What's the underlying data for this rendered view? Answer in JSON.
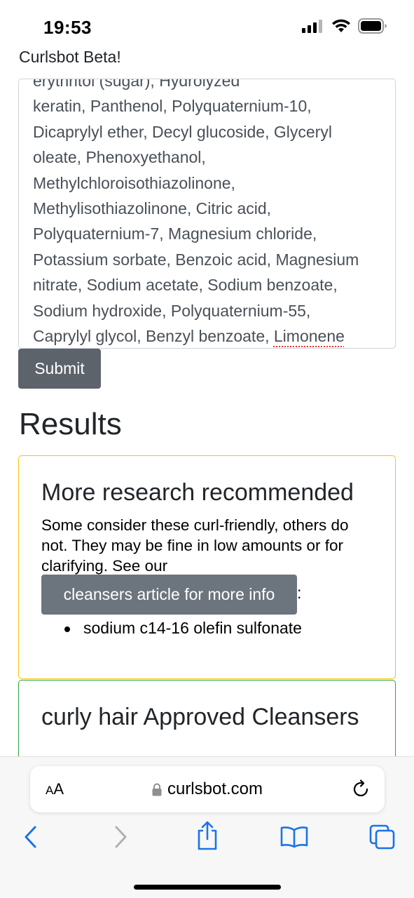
{
  "status": {
    "time": "19:53"
  },
  "app": {
    "title": "Curlsbot Beta!"
  },
  "ingredients_input": {
    "value": "erythritol (sugar), Hydrolyzed\nkeratin, Panthenol, Polyquaternium-10,\nDicaprylyl ether, Decyl glucoside, Glyceryl\noleate, Phenoxyethanol,\nMethylchloroisothiazolinone,\nMethylisothiazolinone, Citric acid,\nPolyquaternium-7, Magnesium chloride,\nPotassium sorbate, Benzoic acid, Magnesium\nnitrate, Sodium acetate, Sodium benzoate,\nSodium hydroxide, Polyquaternium-55,\nCaprylyl glycol, Benzyl benzoate, ",
    "last_word": "Limonene"
  },
  "submit_label": "Submit",
  "results": {
    "heading": "Results",
    "warning_card": {
      "title": "More research recommended",
      "body": "Some consider these curl-friendly, others do not. They may be fine in low amounts or for clarifying. See our",
      "article_button": "cleansers article for more info",
      "colon": ":",
      "items": [
        "sodium c14-16 olefin sulfonate"
      ],
      "border_color": "#ffc107"
    },
    "approved_card": {
      "title": "curly hair Approved Cleansers",
      "border_color": "#28a745"
    }
  },
  "browser": {
    "aa_label": "AA",
    "url": "curlsbot.com"
  },
  "colors": {
    "button_secondary": "#6c757d",
    "button_submit": "#5c636a",
    "ios_blue": "#1a73e8"
  }
}
